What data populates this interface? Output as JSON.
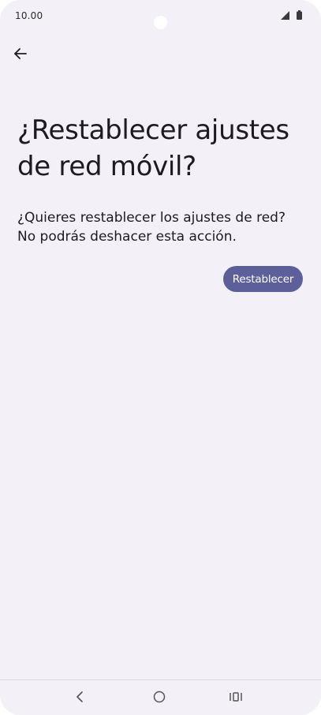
{
  "status_bar": {
    "time": "10.00",
    "icons": [
      "signal-icon",
      "battery-icon"
    ]
  },
  "toolbar": {
    "back_icon": "arrow-left-icon"
  },
  "main": {
    "title": "¿Restablecer ajustes de red móvil?",
    "description_line1": "¿Quieres restablecer los ajustes de red?",
    "description_line2": "No podrás deshacer esta acción.",
    "reset_button_label": "Restablecer"
  },
  "nav_bar": {
    "icons": [
      "nav-back-icon",
      "nav-home-icon",
      "nav-recents-icon"
    ]
  },
  "colors": {
    "background": "#f3f0f8",
    "primary_button": "#5c5f9a",
    "text": "#1c1b20"
  }
}
